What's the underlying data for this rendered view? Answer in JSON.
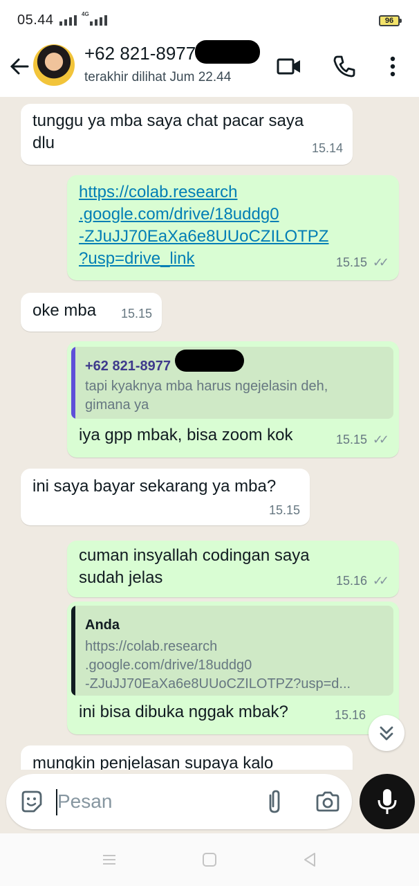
{
  "status_bar": {
    "time": "05.44",
    "network": "4G",
    "battery": "96"
  },
  "header": {
    "contact_name": "+62 821-8977",
    "last_seen": "terakhir dilihat Jum 22.44",
    "icons": [
      "back-arrow-icon",
      "video-call-icon",
      "voice-call-icon",
      "more-options-icon"
    ]
  },
  "messages": [
    {
      "dir": "in",
      "text_line1": "tunggu ya mba saya chat pacar saya",
      "text_line2": "dlu",
      "time": "15.14"
    },
    {
      "dir": "out",
      "link_lines": [
        "https://colab.research",
        ".google.com/drive/18uddg0",
        "-ZJuJJ70EaXa6e8UUoCZILOTPZ",
        "?usp=drive_link"
      ],
      "time": "15.15",
      "status": "read"
    },
    {
      "dir": "in",
      "text": "oke mba",
      "time": "15.15"
    },
    {
      "dir": "out",
      "quote": {
        "author": "+62 821-8977",
        "text_line1": "tapi kyaknya mba harus ngejelasin deh,",
        "text_line2": "gimana ya",
        "accent": "#5e4fd9"
      },
      "text": "iya gpp mbak, bisa zoom kok",
      "time": "15.15",
      "status": "read"
    },
    {
      "dir": "in",
      "text": "ini saya bayar sekarang ya mba?",
      "time": "15.15"
    },
    {
      "dir": "out",
      "text_line1": "cuman insyallah codingan saya",
      "text_line2": "sudah jelas",
      "time": "15.16",
      "status": "read"
    },
    {
      "dir": "out",
      "quote": {
        "author": "Anda",
        "text_line1": "https://colab.research",
        "text_line2": ".google.com/drive/18uddg0",
        "text_line3": "-ZJuJJ70EaXa6e8UUoCZILOTPZ?usp=d...",
        "accent": "#111b21"
      },
      "text": "ini bisa dibuka nggak mbak?",
      "time": "15.16"
    },
    {
      "dir": "in",
      "text": "mungkin penjelasan supaya kalo"
    }
  ],
  "composer": {
    "placeholder": "Pesan",
    "icons": [
      "emoji-icon",
      "attach-icon",
      "camera-icon",
      "mic-icon"
    ]
  },
  "colors": {
    "incoming": "#ffffff",
    "outgoing": "#d9fdd3",
    "link": "#027eb5",
    "wallpaper": "#efeae2"
  }
}
